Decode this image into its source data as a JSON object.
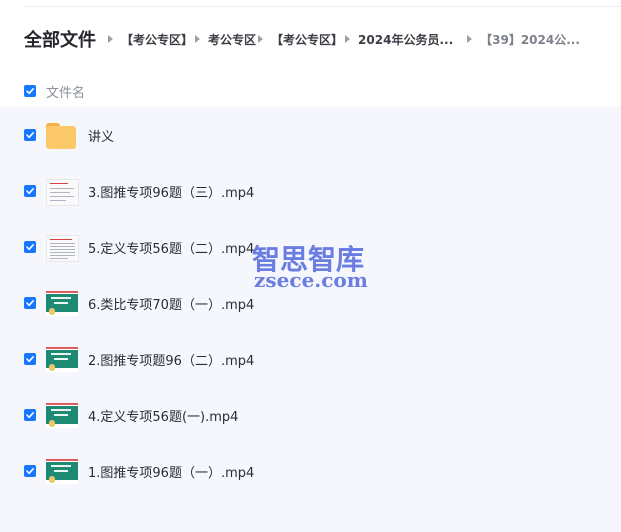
{
  "breadcrumb": {
    "root": "全部文件",
    "items": [
      "【考公专区】",
      "考公专区",
      "【考公专区】",
      "2024年公务员...",
      "【39】2024公..."
    ]
  },
  "list_header": {
    "label": "文件名",
    "checked": true
  },
  "files": [
    {
      "name": "讲义",
      "type": "folder",
      "checked": true
    },
    {
      "name": "3.图推专项96题（三）.mp4",
      "type": "video",
      "checked": true
    },
    {
      "name": "5.定义专项56题（二）.mp4",
      "type": "video",
      "checked": true
    },
    {
      "name": "6.类比专项70题（一）.mp4",
      "type": "video",
      "checked": true
    },
    {
      "name": "2.图推专项题96（二）.mp4",
      "type": "video",
      "checked": true
    },
    {
      "name": "4.定义专项56题(一).mp4",
      "type": "video",
      "checked": true
    },
    {
      "name": "1.图推专项96题（一）.mp4",
      "type": "video",
      "checked": true
    }
  ],
  "watermark": {
    "line1": "智思智库",
    "line2": "zsece.com"
  },
  "colors": {
    "checkbox": "#1677ff",
    "list_bg": "#f6f7fc",
    "folder": "#fcc96a",
    "watermark": "#5b6fe0"
  }
}
